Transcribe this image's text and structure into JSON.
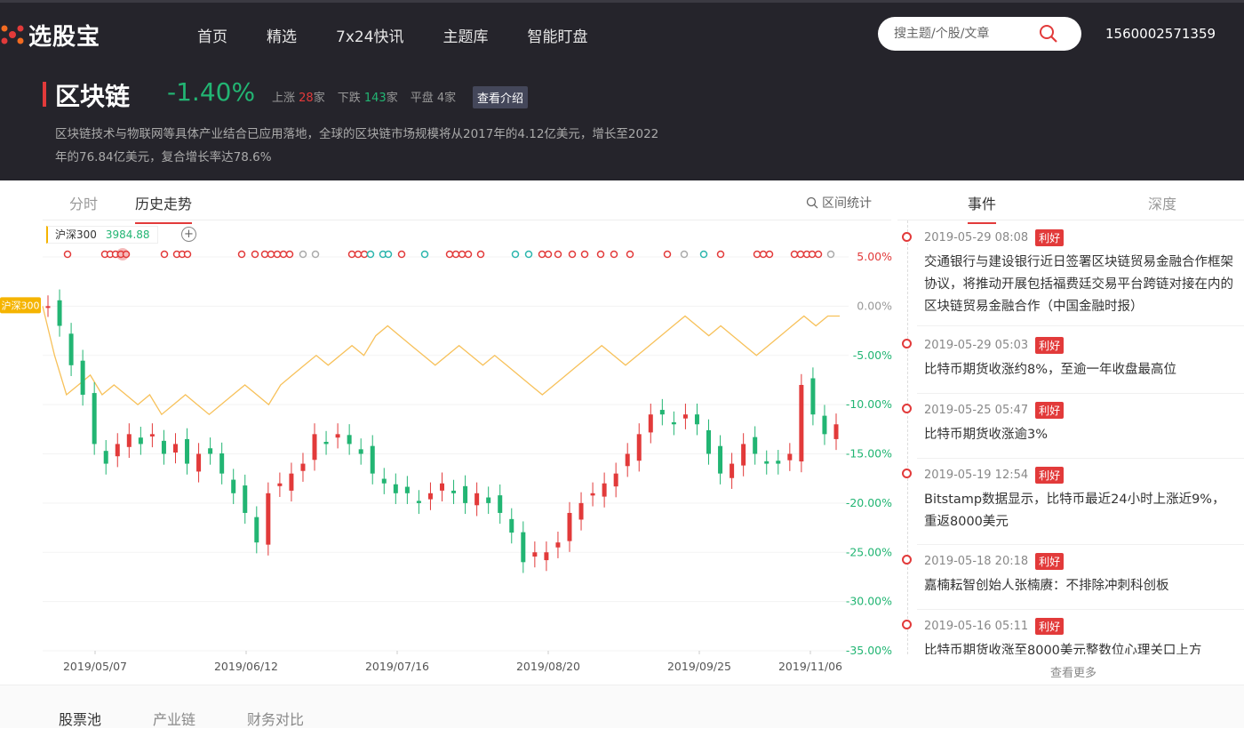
{
  "brand": {
    "name": "选股宝",
    "accent": "#e23a3a"
  },
  "nav": [
    "首页",
    "精选",
    "7x24快讯",
    "主题库",
    "智能盯盘"
  ],
  "search": {
    "placeholder": "搜主题/个股/文章"
  },
  "user": {
    "id": "1560002571359"
  },
  "theme": {
    "title": "区块链",
    "change": "-1.40%",
    "up_label": "上涨",
    "up_count": "28",
    "up_unit": "家",
    "down_label": "下跌",
    "down_count": "143",
    "down_unit": "家",
    "flat_label": "平盘",
    "flat_count": "4",
    "flat_unit": "家",
    "intro_button": "查看介绍",
    "description": "区块链技术与物联网等具体产业结合已应用落地，全球的区块链市场规模将从2017年的4.12亿美元，增长至2022年的76.84亿美元，复合增长率达78.6%"
  },
  "chart_tabs": {
    "items": [
      "分时",
      "历史走势"
    ],
    "active": "历史走势",
    "range_stat": "区间统计"
  },
  "index_tag": {
    "name": "沪深300",
    "value": "3984.88",
    "axis_tag": "沪深300"
  },
  "chart_data": {
    "type": "line",
    "x_ticks": [
      "2019/05/07",
      "2019/06/12",
      "2019/07/16",
      "2019/08/20",
      "2019/09/25",
      "2019/11/06"
    ],
    "y_ticks": [
      "5.00%",
      "0.00%",
      "-5.00%",
      "-10.00%",
      "-15.00%",
      "-20.00%",
      "-25.00%",
      "-30.00%",
      "-35.00%"
    ],
    "ylim": [
      -35,
      5
    ],
    "series": [
      {
        "name": "沪深300",
        "color": "#f7c15a",
        "values": [
          0,
          -5,
          -9,
          -8,
          -7,
          -9,
          -8,
          -9,
          -10,
          -9,
          -11,
          -10,
          -9,
          -10,
          -11,
          -10,
          -9,
          -8,
          -9,
          -10,
          -8,
          -7,
          -6,
          -5,
          -6,
          -5,
          -4,
          -5,
          -3,
          -2,
          -3,
          -4,
          -5,
          -6,
          -5,
          -4,
          -5,
          -6,
          -5,
          -6,
          -7,
          -8,
          -9,
          -8,
          -7,
          -6,
          -5,
          -4,
          -5,
          -6,
          -5,
          -4,
          -3,
          -2,
          -1,
          -2,
          -3,
          -2,
          -3,
          -4,
          -5,
          -4,
          -3,
          -2,
          -1,
          -2,
          -1,
          -1
        ]
      },
      {
        "name": "区块链",
        "type": "candlestick",
        "up_color": "#e23a3a",
        "down_color": "#22b573",
        "values": [
          0,
          -2,
          -6,
          -9,
          -14,
          -16,
          -14,
          -13,
          -14,
          -13,
          -15,
          -14,
          -16,
          -15,
          -15,
          -17,
          -19,
          -21,
          -24,
          -19,
          -18,
          -17,
          -16,
          -13,
          -14,
          -13,
          -14,
          -15,
          -17,
          -18,
          -19,
          -19,
          -20,
          -19,
          -18,
          -19,
          -20,
          -19,
          -20,
          -21,
          -23,
          -26,
          -25,
          -25,
          -24,
          -21,
          -20,
          -19,
          -18,
          -17,
          -15,
          -13,
          -11,
          -11,
          -12,
          -11,
          -12,
          -15,
          -17,
          -16,
          -14,
          -15,
          -16,
          -16,
          -15,
          -8,
          -11,
          -13,
          -12
        ]
      }
    ],
    "events_markers": {
      "red": "#e23a3a",
      "teal": "#2bb5ad",
      "gray": "#aaaaaa"
    }
  },
  "side_tabs": {
    "items": [
      "事件",
      "深度"
    ],
    "active": "事件"
  },
  "events": [
    {
      "time": "2019-05-29 08:08",
      "badge": "利好",
      "text": "交通银行与建设银行近日签署区块链贸易金融合作框架协议，将推动开展包括福费廷交易平台跨链对接在内的区块链贸易金融合作（中国金融时报）"
    },
    {
      "time": "2019-05-29 05:03",
      "badge": "利好",
      "text": "比特币期货收涨约8%，至逾一年收盘最高位"
    },
    {
      "time": "2019-05-25 05:47",
      "badge": "利好",
      "text": "比特币期货收涨逾3%"
    },
    {
      "time": "2019-05-19 12:54",
      "badge": "利好",
      "text": "Bitstamp数据显示，比特币最近24小时上涨近9%，重返8000美元"
    },
    {
      "time": "2019-05-18 20:18",
      "badge": "利好",
      "text": "嘉楠耘智创始人张楠赓：不排除冲刺科创板"
    },
    {
      "time": "2019-05-16 05:11",
      "badge": "利好",
      "text": "比特币期货收涨至8000美元整数位心理关口上方"
    }
  ],
  "more_label": "查看更多",
  "bottom_tabs": {
    "items": [
      "股票池",
      "产业链",
      "财务对比"
    ],
    "active": "股票池"
  }
}
